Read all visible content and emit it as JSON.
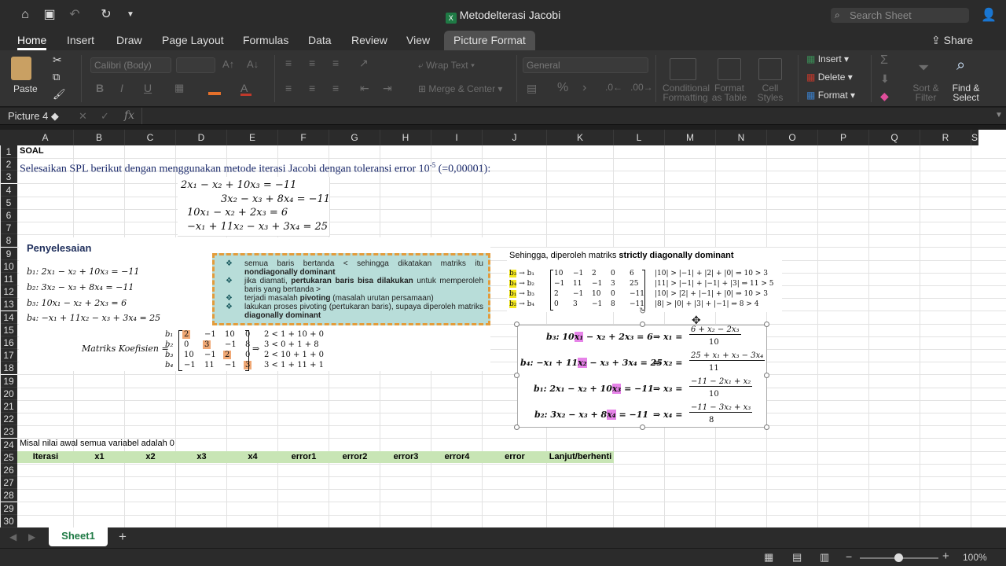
{
  "window": {
    "title": "Metodelterasi Jacobi",
    "search_placeholder": "Search Sheet",
    "share": "Share"
  },
  "tabs": [
    "Home",
    "Insert",
    "Draw",
    "Page Layout",
    "Formulas",
    "Data",
    "Review",
    "View",
    "Picture Format"
  ],
  "ribbon": {
    "paste": "Paste",
    "font": "Calibri (Body)",
    "wrap_text": "Wrap Text",
    "merge_center": "Merge & Center",
    "number_format": "General",
    "conditional": [
      "Conditional",
      "Formatting"
    ],
    "format_table": [
      "Format",
      "as Table"
    ],
    "cell_styles": [
      "Cell",
      "Styles"
    ],
    "insert": "Insert",
    "delete": "Delete",
    "format": "Format",
    "sort_filter": [
      "Sort &",
      "Filter"
    ],
    "find_select": [
      "Find &",
      "Select"
    ]
  },
  "formula_bar": {
    "name_box": "Picture 4",
    "fx": "fx"
  },
  "columns": [
    "A",
    "B",
    "C",
    "D",
    "E",
    "F",
    "G",
    "H",
    "I",
    "J",
    "K",
    "L",
    "M",
    "N",
    "O",
    "P",
    "Q",
    "R",
    "S"
  ],
  "rows": [
    "1",
    "2",
    "3",
    "4",
    "5",
    "6",
    "7",
    "8",
    "9",
    "10",
    "11",
    "12",
    "13",
    "14",
    "15",
    "16",
    "17",
    "18",
    "19",
    "20",
    "21",
    "22",
    "23",
    "24",
    "25",
    "26",
    "27",
    "28",
    "29",
    "30"
  ],
  "cells": {
    "a1": "SOAL",
    "a2_main": "Selesaikan SPL berikut dengan menggunakan metode iterasi Jacobi dengan toleransi error 10",
    "a2_sup": "-5",
    "a2_tail": " (=0,00001):",
    "a24": "Misal nilai awal semua variabel adalah 0"
  },
  "spl": [
    "2x₁ − x₂ + 10x₃ = −11",
    "3x₂ − x₃ + 8x₄ = −11",
    "10x₁ − x₂ + 2x₃ = 6",
    "−x₁ + 11x₂ − x₃ + 3x₄ = 25"
  ],
  "penyelesaian": {
    "title": "Penyelesaian",
    "eqs": [
      "b₁: 2x₁ − x₂ + 10x₃ = −11",
      "b₂: 3x₂ − x₃ + 8x₄ = −11",
      "b₃: 10x₁ − x₂ + 2x₃ = 6",
      "b₄: −x₁ + 11x₂ − x₃ + 3x₄ = 25"
    ],
    "koef_label": "Matriks Koefisien =",
    "matrix_rows": [
      "b₁",
      "b₂",
      "b₃",
      "b₄"
    ],
    "matrix": [
      [
        "2",
        "−1",
        "10",
        "0"
      ],
      [
        "0",
        "3",
        "−1",
        "8"
      ],
      [
        "10",
        "−1",
        "2",
        "0"
      ],
      [
        "−1",
        "11",
        "−1",
        "3"
      ]
    ],
    "checks": [
      "2 < 1 + 10 + 0",
      "3 < 0 + 1 + 8",
      "2 < 10 + 1 + 0",
      "3 < 1 + 11 + 1"
    ]
  },
  "notes": [
    [
      "semua baris bertanda < sehingga dikatakan matriks itu ",
      "nondiagonally dominant",
      ""
    ],
    [
      "jika diamati, ",
      "pertukaran baris bisa dilakukan",
      " untuk memperoleh baris yang bertanda >"
    ],
    [
      "terjadi masalah ",
      "pivoting",
      " (masalah urutan persamaan)"
    ],
    [
      "lakukan proses pivoting (pertukaran baris), supaya diperoleh matriks ",
      "diagonally dominant",
      ""
    ]
  ],
  "sehingga": {
    "text": "Sehingga, diperoleh matriks ",
    "bold": "strictly diagonally dominant",
    "swaps": [
      "b₃ → b₁",
      "b₄ → b₂",
      "b₁ → b₃",
      "b₂ → b₄"
    ],
    "matrix": [
      [
        "10",
        "−1",
        "2",
        "0",
        "6"
      ],
      [
        "−1",
        "11",
        "−1",
        "3",
        "25"
      ],
      [
        "2",
        "−1",
        "10",
        "0",
        "−11"
      ],
      [
        "0",
        "3",
        "−1",
        "8",
        "−11"
      ]
    ],
    "checks": [
      "|10| > |−1| + |2| + |0| ⇒ 10 > 3",
      "|11| > |−1| + |−1| + |3| ⇒ 11 > 5",
      "|10| > |2| + |−1| + |0| ⇒ 10 > 3",
      "|8| > |0| + |3| + |−1| ⇒ 8 > 4"
    ]
  },
  "iter_eqs": [
    {
      "lhs_pre": "b₃: 10",
      "hl": "x₁",
      "lhs_post": " − x₂ + 2x₃ = 6",
      "var": "x₁",
      "num": "6 + x₂ − 2x₃",
      "den": "10"
    },
    {
      "lhs_pre": "b₄: −x₁ + 11",
      "hl": "x₂",
      "lhs_post": " − x₃ + 3x₄ = 25",
      "var": "x₂",
      "num": "25 + x₁ + x₃ − 3x₄",
      "den": "11"
    },
    {
      "lhs_pre": "b₁: 2x₁ − x₂ + 10",
      "hl": "x₃",
      "lhs_post": " = −11",
      "var": "x₃",
      "num": "−11 − 2x₁ + x₂",
      "den": "10"
    },
    {
      "lhs_pre": "b₂: 3x₂ − x₃ + 8",
      "hl": "x₄",
      "lhs_post": " = −11",
      "var": "x₄",
      "num": "−11 − 3x₂ + x₃",
      "den": "8"
    }
  ],
  "table_header": [
    "Iterasi",
    "x1",
    "x2",
    "x3",
    "x4",
    "error1",
    "error2",
    "error3",
    "error4",
    "error",
    "Lanjut/berhenti"
  ],
  "sheet_tab": "Sheet1",
  "zoom": "100%"
}
